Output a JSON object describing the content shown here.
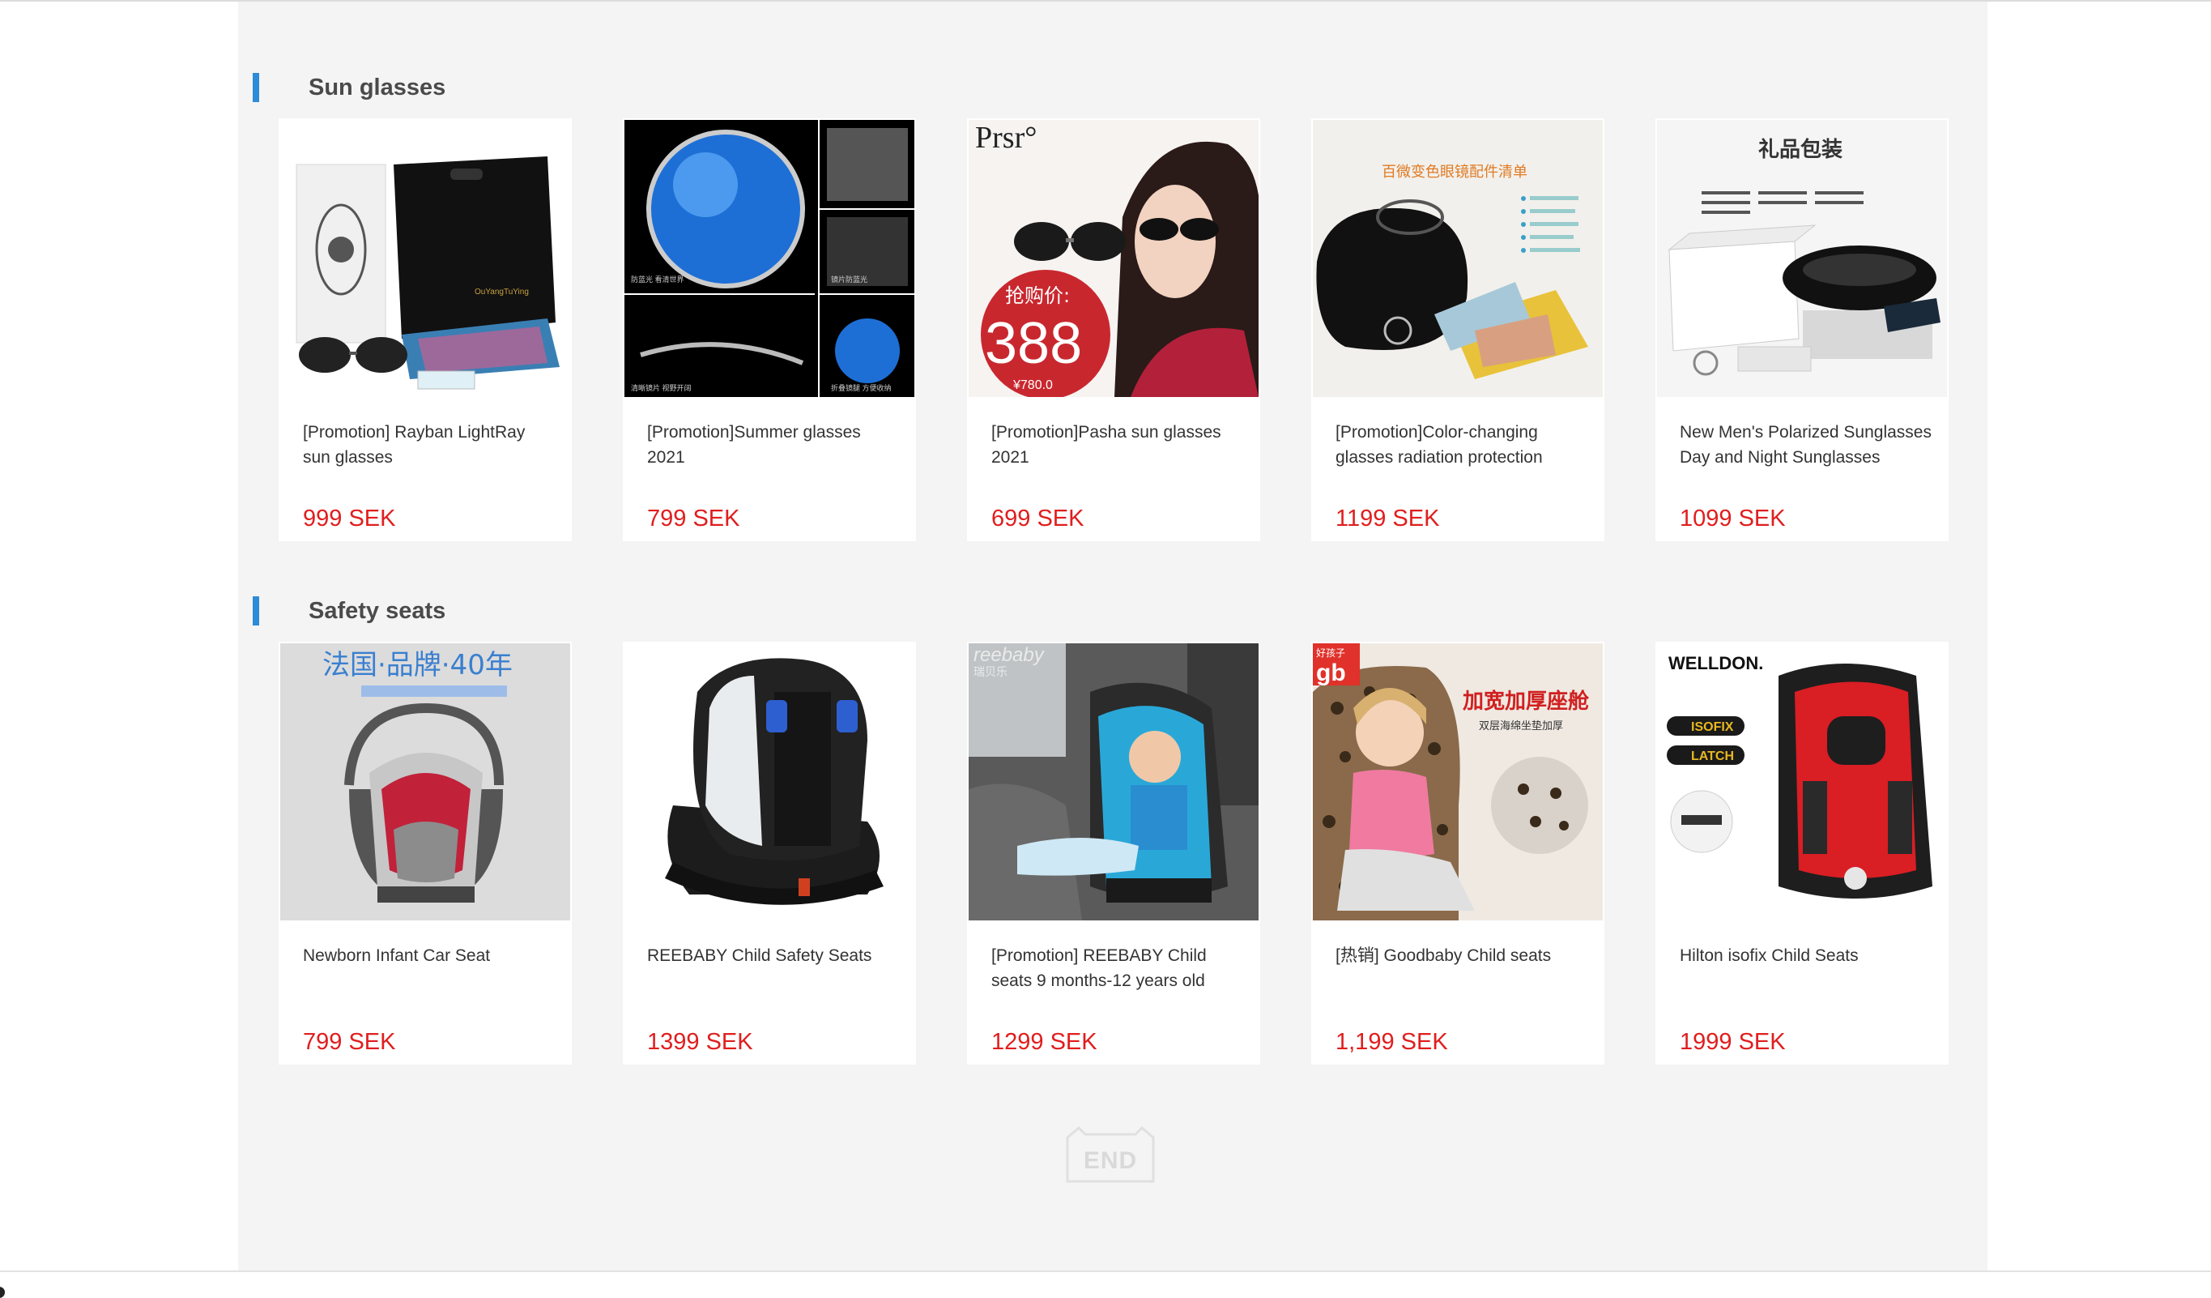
{
  "sections": [
    {
      "title": "Sun glasses",
      "products": [
        {
          "title": "[Promotion] Rayban LightRay sun glasses",
          "price": "999 SEK",
          "image": "sunglasses-gift-box-image"
        },
        {
          "title": "[Promotion]Summer glasses 2021",
          "price": "799 SEK",
          "image": "blue-lens-sunglasses-closeup-image",
          "image_text": [
            "防蓝光 看清世界",
            "清晰镜片 视野开阔",
            "镜片防蓝光",
            "折叠镜腿 方便收纳"
          ]
        },
        {
          "title": "[Promotion]Pasha sun glasses 2021",
          "price": "699 SEK",
          "image": "model-wearing-sunglasses-image",
          "image_text": [
            "Prsr°",
            "抢购价:",
            "388",
            "¥780.0"
          ]
        },
        {
          "title": "[Promotion]Color-changing glasses radiation protection",
          "price": "1199 SEK",
          "image": "glasses-case-accessories-image",
          "image_text": [
            "百微变色眼镜配件清单"
          ]
        },
        {
          "title": "New Men's Polarized Sunglasses Day and Night Sunglasses",
          "price": "1099 SEK",
          "image": "gift-packaging-image",
          "image_text": [
            "礼品包装"
          ]
        }
      ]
    },
    {
      "title": "Safety seats",
      "products": [
        {
          "title": "Newborn Infant Car Seat",
          "price": "799 SEK",
          "image": "infant-carrier-seat-image",
          "image_text": [
            "法国·品牌·40年"
          ]
        },
        {
          "title": "REEBABY Child Safety Seats",
          "price": "1399 SEK",
          "image": "black-child-seat-image"
        },
        {
          "title": "[Promotion] REEBABY Child seats 9 months-12 years old",
          "price": "1299 SEK",
          "image": "child-in-car-seat-image",
          "image_text": [
            "reebaby",
            "瑞贝乐"
          ]
        },
        {
          "title": "[热销] Goodbaby Child seats",
          "price": "1,199 SEK",
          "image": "girl-in-booster-seat-image",
          "image_text": [
            "好孩子",
            "gb",
            "加宽加厚座舱",
            "双层海绵坐垫加厚"
          ]
        },
        {
          "title": "Hilton isofix Child Seats",
          "price": "1999 SEK",
          "image": "red-child-seat-image",
          "image_text": [
            "WELLDON.",
            "ISOFIX",
            "LATCH"
          ]
        }
      ]
    }
  ],
  "footer": {
    "end_label": "END"
  },
  "colors": {
    "accent_bar": "#2e8bd8",
    "price": "#e01e1e",
    "page_background": "#f4f4f4",
    "card_background": "#ffffff"
  }
}
